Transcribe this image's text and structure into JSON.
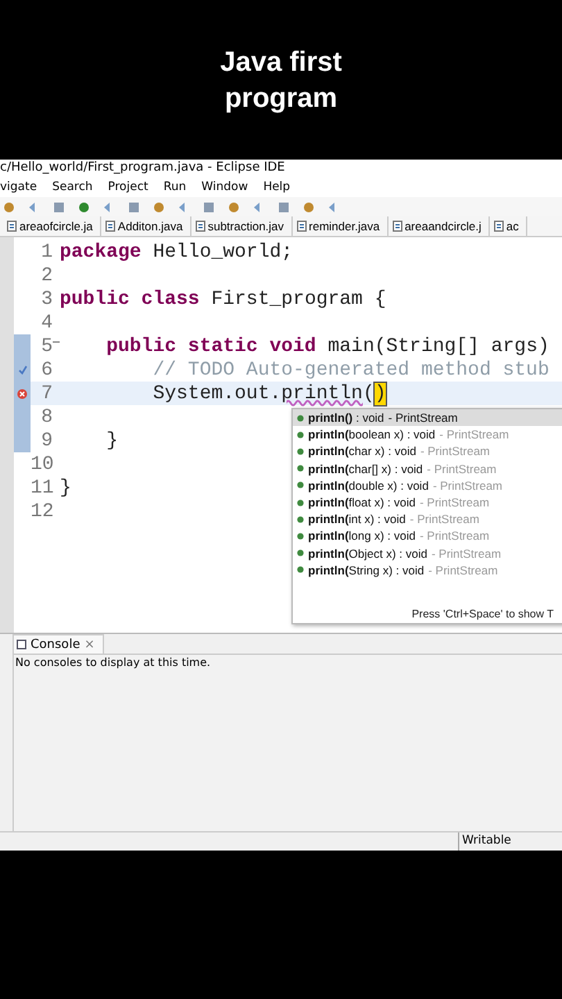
{
  "video_title": "Java first program",
  "window": {
    "title": "c/Hello_world/First_program.java - Eclipse IDE"
  },
  "menu": [
    "vigate",
    "Search",
    "Project",
    "Run",
    "Window",
    "Help"
  ],
  "tabs": [
    {
      "label": "areaofcircle.ja",
      "selected": false
    },
    {
      "label": "Additon.java",
      "selected": false
    },
    {
      "label": "subtraction.jav",
      "selected": false
    },
    {
      "label": "reminder.java",
      "selected": false
    },
    {
      "label": "areaandcircle.j",
      "selected": false
    },
    {
      "label": "ac",
      "selected": false
    }
  ],
  "editor": {
    "lines": [
      {
        "number": "1",
        "kind": "plain",
        "current": false,
        "tokens": [
          {
            "text": "package",
            "kind": "keyword"
          },
          {
            "text": " Hello_world;",
            "kind": "plain"
          }
        ]
      },
      {
        "number": "2",
        "kind": "plain",
        "current": false
      },
      {
        "number": "3",
        "kind": "plain",
        "current": false,
        "tokens": [
          {
            "text": "public class",
            "kind": "keyword"
          },
          {
            "text": " First_program {",
            "kind": "plain"
          }
        ]
      },
      {
        "number": "4",
        "kind": "plain",
        "current": false
      },
      {
        "number": "5",
        "kind": "fold",
        "current": false,
        "tokens": [
          {
            "text": "    public static void",
            "kind": "keyword"
          },
          {
            "text": " main(String[] args)",
            "kind": "plain"
          }
        ]
      },
      {
        "number": "6",
        "kind": "task",
        "current": false,
        "tokens": [
          {
            "text": "        // TODO Auto-generated method stub",
            "kind": "comment"
          }
        ]
      },
      {
        "number": "7",
        "kind": "error",
        "current": true,
        "tokens": [
          {
            "text": "        System.out.",
            "kind": "plain"
          },
          {
            "text": "println",
            "kind": "error"
          },
          {
            "text": "(",
            "kind": "plain"
          },
          {
            "text": ")",
            "kind": "bracket"
          }
        ]
      },
      {
        "number": "8",
        "kind": "plain",
        "current": false
      },
      {
        "number": "9",
        "kind": "plain",
        "current": false,
        "tokens": [
          {
            "text": "    }",
            "kind": "plain"
          }
        ]
      },
      {
        "number": "10",
        "kind": "plain",
        "current": false
      },
      {
        "number": "11",
        "kind": "plain",
        "current": false,
        "tokens": [
          {
            "text": "}",
            "kind": "plain"
          }
        ]
      },
      {
        "number": "12",
        "kind": "plain",
        "current": false
      }
    ]
  },
  "completion": {
    "items": [
      {
        "signature": "**println()** : void",
        "owner": "- PrintStream",
        "selected": true
      },
      {
        "signature": "**println(**boolean x) : void",
        "owner": "- PrintStream",
        "selected": false
      },
      {
        "signature": "**println(**char x) : void",
        "owner": "- PrintStream",
        "selected": false
      },
      {
        "signature": "**println(**char[] x) : void",
        "owner": "- PrintStream",
        "selected": false
      },
      {
        "signature": "**println(**double x) : void",
        "owner": "- PrintStream",
        "selected": false
      },
      {
        "signature": "**println(**float x) : void",
        "owner": "- PrintStream",
        "selected": false
      },
      {
        "signature": "**println(**int x) : void",
        "owner": "- PrintStream",
        "selected": false
      },
      {
        "signature": "**println(**long x) : void",
        "owner": "- PrintStream",
        "selected": false
      },
      {
        "signature": "**println(**Object x) : void",
        "owner": "- PrintStream",
        "selected": false
      },
      {
        "signature": "**println(**String x) : void",
        "owner": "- PrintStream",
        "selected": false
      }
    ],
    "hint": "Press 'Ctrl+Space' to show T"
  },
  "console": {
    "tab": "Console",
    "close": "×",
    "message": "No consoles to display at this time."
  },
  "status_bar": {
    "mode": "Writable"
  }
}
